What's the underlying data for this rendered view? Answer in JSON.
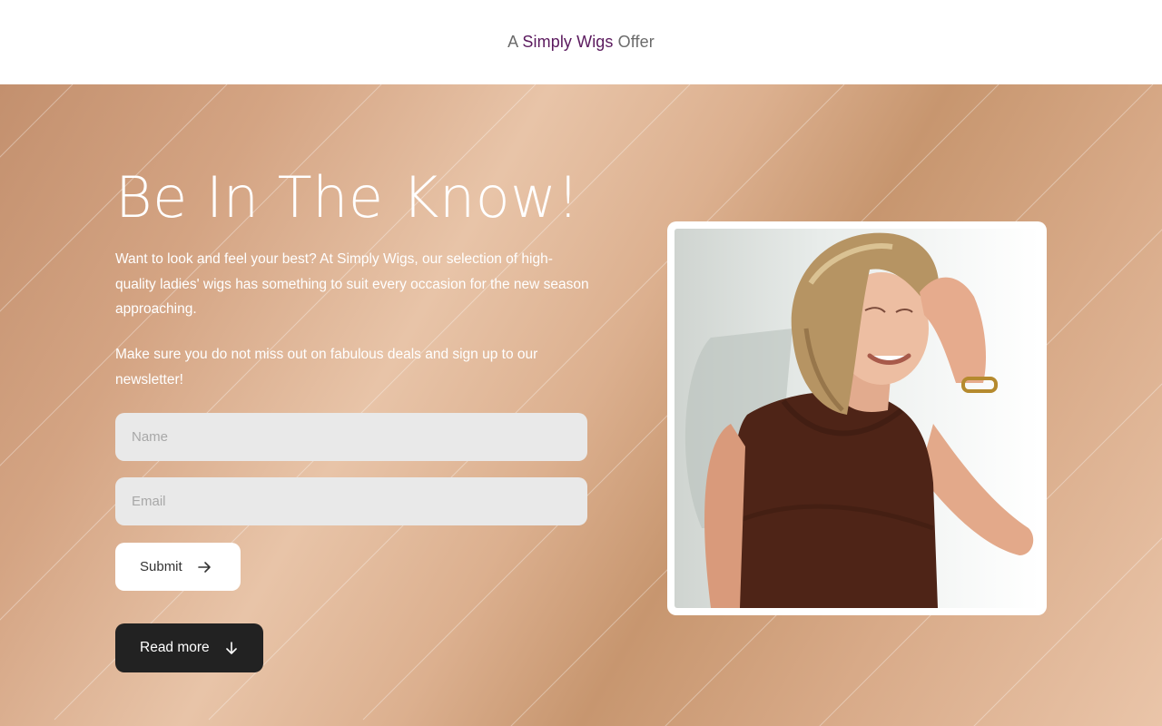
{
  "header": {
    "prefix": "A",
    "brand": "Simply Wigs",
    "suffix": "Offer"
  },
  "hero": {
    "title": "Be In The Know!",
    "paragraph_1": "Want to look and feel your best? At Simply Wigs, our selection of high-quality ladies' wigs has something to suit every occasion for the new season approaching.",
    "paragraph_2": "Make sure you do not miss out on fabulous deals and sign up to our newsletter!",
    "image_subject": "woman-with-blonde-bob-wig"
  },
  "form": {
    "name_placeholder": "Name",
    "email_placeholder": "Email",
    "submit_label": "Submit"
  },
  "read_more_label": "Read more",
  "icons": {
    "submit": "arrow-right-icon",
    "read_more": "arrow-down-icon"
  },
  "colors": {
    "brand": "#5b1a5e",
    "hero_bg": "#d4a483",
    "button_dark": "#222222",
    "input_bg": "#e9e9e9"
  }
}
